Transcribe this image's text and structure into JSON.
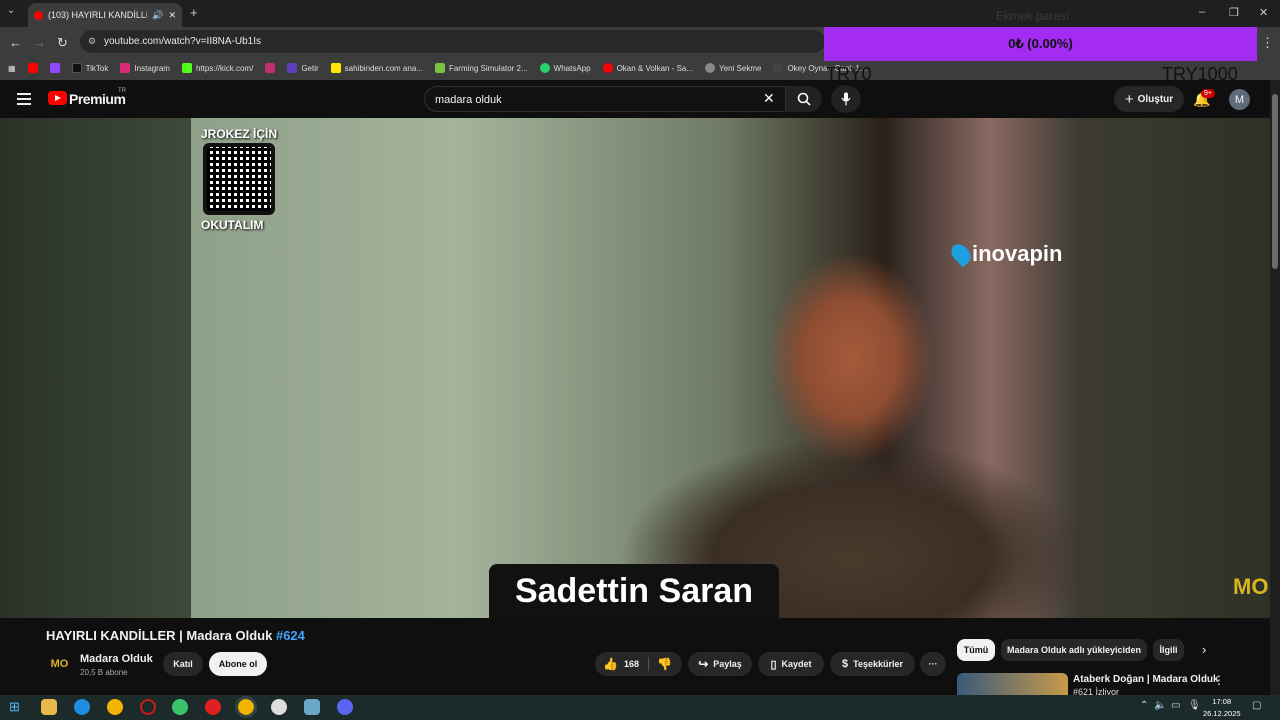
{
  "browser": {
    "tab_title": "(103) HAYIRLI KANDİLLER | ",
    "url": "youtube.com/watch?v=II8NA-Ub1Is",
    "bookmarks": [
      "TikTok",
      "Instagram",
      "https://kick.com/",
      "Getir",
      "sahibinden.com ana...",
      "Farming Simulator 2...",
      "WhatsApp",
      "Okan & Volkan - Sa...",
      "Yeni Sekme",
      "Okey Oyna - Canlı 1..."
    ]
  },
  "overlay": {
    "title": "Ekmek parası",
    "value_text": "0₺ (0.00%)",
    "progress": 0,
    "min_label": "TRY0",
    "max_label": "TRY1000",
    "color": "#a42cf2"
  },
  "youtube": {
    "brand": "Premium",
    "region": "TR",
    "search_query": "madara olduk",
    "create_label": "Oluştur",
    "notif_badge": "9+",
    "avatar_letter": "M"
  },
  "video": {
    "qr_top": "JROKEZ İÇİN",
    "qr_bottom": "OKUTALIM",
    "sponsor": "inovapin",
    "caption": "Sadettin Saran",
    "watermark": "MO"
  },
  "details": {
    "title": "HAYIRLI KANDİLLER | Madara Olduk ",
    "title_tag": "#624",
    "channel": "Madara Olduk",
    "channel_avatar": "MO",
    "subscribers": "20,5 B abone",
    "join": "Katıl",
    "subscribe": "Abone ol",
    "likes": "168",
    "share": "Paylaş",
    "save": "Kaydet",
    "thanks": "Teşekkürler",
    "more": "···"
  },
  "chips": [
    "Tümü",
    "Madara Olduk adlı yükleyiciden",
    "İlgili"
  ],
  "recommendation": {
    "title": "Ataberk Doğan | Madara Olduk",
    "sub": "#621 İzliyor"
  },
  "taskbar": {
    "time": "17:08",
    "date": "26.12.2025"
  }
}
